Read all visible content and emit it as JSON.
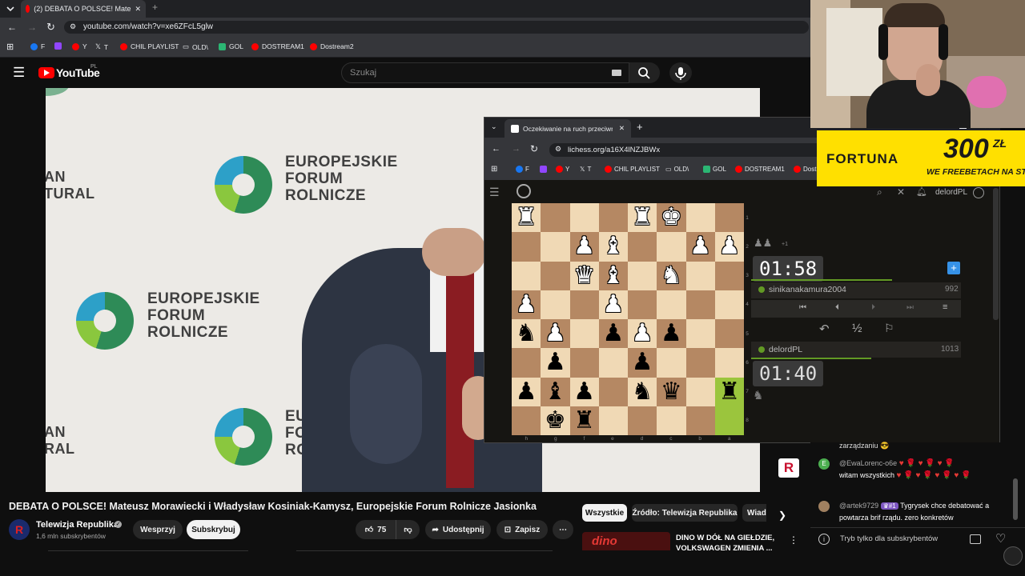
{
  "browser": {
    "tab_title": "(2) DEBATA O POLSCE! Mate",
    "url": "youtube.com/watch?v=xe6ZFcL5glw",
    "bookmarks": [
      "F",
      "Y",
      "T",
      "CHIL PLAYLIST",
      "OLD\\",
      "GOL",
      "DOSTREAM1",
      "Dostream2"
    ]
  },
  "youtube": {
    "logo": "YouTube",
    "region": "PL",
    "search_placeholder": "Szukaj",
    "video_title": "DEBATA O POLSCE! Mateusz Morawiecki i Władysław Kosiniak-Kamysz, Europejskie Forum Rolnicze Jasionka",
    "channel_name": "Telewizja Republika",
    "subscribers": "1,6 mln subskrybentów",
    "support_label": "Wesprzyj",
    "subscribe_label": "Subskrybuj",
    "likes": "75",
    "share_label": "Udostępnij",
    "save_label": "Zapisz",
    "chips": [
      "Wszystkie",
      "Źródło: Telewizja Republika",
      "Wiad"
    ],
    "rec_title_1": "DINO W DÓŁ NA GIEŁDZIE,",
    "rec_title_2": "VOLKSWAGEN ZMIENIA ...",
    "rec_thumb_text": "dino"
  },
  "video_content": {
    "org_line1": "EUROPEJSKIE",
    "org_line2": "FORUM",
    "org_line3": "ROLNICZE",
    "partial_left_top": "AN",
    "partial_left_bottom": "TURAL",
    "partial_eu": "EUR",
    "partial_fo": "FOR",
    "partial_ro": "ROL",
    "partial_an": "AN",
    "partial_ral": "RAL"
  },
  "lichess_window": {
    "tab_title": "Oczekiwanie na ruch przeciwnika",
    "url": "lichess.org/a16X4lNZJBWx",
    "bookmarks": [
      "F",
      "Y",
      "T",
      "CHIL PLAYLIST",
      "OLD\\",
      "GOL",
      "DOSTREAM1",
      "Dost"
    ],
    "username": "delordPL",
    "opponent": {
      "name": "sinikanakamura2004",
      "rating": "992",
      "clock": "01:58"
    },
    "player": {
      "name": "delordPL",
      "rating": "1013",
      "clock": "01:40"
    },
    "captured_bonus": "+1",
    "draw_label": "½",
    "ranks": [
      "1",
      "2",
      "3",
      "4",
      "5",
      "6",
      "7",
      "8"
    ],
    "files": [
      "h",
      "g",
      "f",
      "e",
      "d",
      "c",
      "b",
      "a"
    ],
    "board": [
      [
        "wR",
        "",
        "",
        "",
        "wR",
        "wK",
        "",
        ""
      ],
      [
        "",
        "",
        "wP",
        "wB",
        "",
        "",
        "wP",
        "wP"
      ],
      [
        "",
        "",
        "wQ",
        "wB",
        "",
        "wN",
        "",
        ""
      ],
      [
        "wP",
        "",
        "",
        "wP",
        "",
        "",
        "",
        ""
      ],
      [
        "bN",
        "wP",
        "",
        "bP",
        "wP",
        "bP",
        "",
        ""
      ],
      [
        "",
        "bP",
        "",
        "",
        "bP",
        "",
        "",
        ""
      ],
      [
        "bP",
        "bB",
        "bP",
        "",
        "bN",
        "bQ",
        "",
        "bR"
      ],
      [
        "",
        "bK",
        "bR",
        "",
        "",
        "",
        "",
        ""
      ]
    ]
  },
  "ad": {
    "brand": "FORTUNA",
    "amount": "300",
    "currency": "ZŁ",
    "tagline": "WE FREEBETACH NA STAR"
  },
  "chat": {
    "partial_top": "zarządzaniu",
    "messages": [
      {
        "author": "@EwaLorenc-o6e",
        "text": "witam wszystkich",
        "avatar_letter": "E",
        "avatar_color": "#4caf50"
      },
      {
        "author": "@artek9729",
        "badge": "#1",
        "text": "Tygrysek chce debatować a powtarza brif rządu. zero konkretów",
        "avatar_color": "#a08060"
      }
    ],
    "input_placeholder": "Tryb tylko dla subskrybentów"
  }
}
